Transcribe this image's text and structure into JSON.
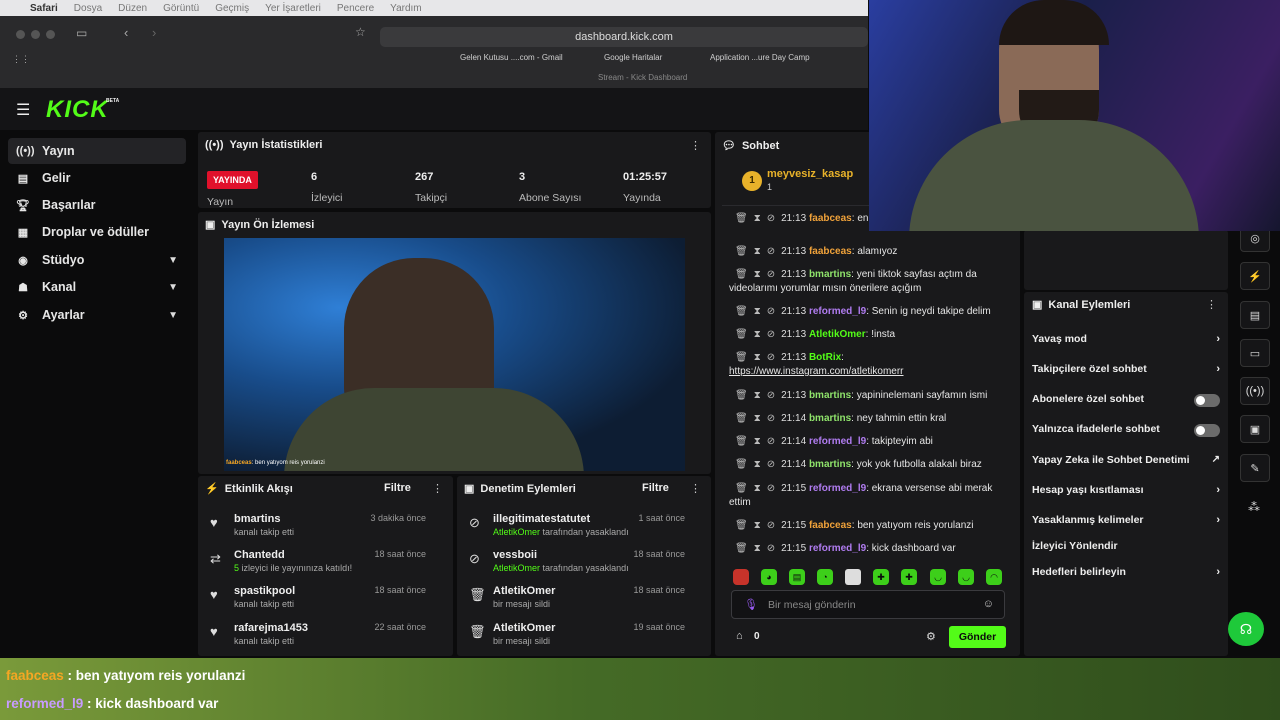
{
  "menubar": {
    "apple": "",
    "items": [
      "Safari",
      "Dosya",
      "Düzen",
      "Görüntü",
      "Geçmiş",
      "Yer İşaretleri",
      "Pencere",
      "Yardım"
    ]
  },
  "browser": {
    "url": "dashboard.kick.com",
    "bookmarks": [
      "Gelen Kutusu ....com - Gmail",
      "Google Haritalar",
      "Application ...ure Day Camp"
    ],
    "tab": "Stream - Kick Dashboard"
  },
  "brand": {
    "name": "KICK",
    "beta": "BETA",
    "accent": "#53fc18"
  },
  "sidebar": {
    "items": [
      {
        "label": "Yayın",
        "icon": "broadcast-icon",
        "active": true
      },
      {
        "label": "Gelir",
        "icon": "chart-icon"
      },
      {
        "label": "Başarılar",
        "icon": "trophy-icon"
      },
      {
        "label": "Droplar ve ödüller",
        "icon": "gift-icon"
      },
      {
        "label": "Stüdyo",
        "icon": "studio-icon",
        "chevron": true
      },
      {
        "label": "Kanal",
        "icon": "channel-icon",
        "chevron": true
      },
      {
        "label": "Ayarlar",
        "icon": "gear-icon",
        "chevron": true
      }
    ]
  },
  "stats": {
    "title": "Yayın İstatistikleri",
    "live": "YAYINDA",
    "stream_label": "Yayın",
    "viewers": "6",
    "viewers_label": "İzleyici",
    "followers": "267",
    "followers_label": "Takipçi",
    "subs": "3",
    "subs_label": "Abone Sayısı",
    "duration": "01:25:57",
    "duration_label": "Yayında"
  },
  "preview": {
    "title": "Yayın Ön İzlemesi",
    "caption_user": "faabceas",
    "caption_text": "ben yatıyom reis yorulanzi"
  },
  "activity": {
    "title": "Etkinlik Akışı",
    "filter": "Filtre",
    "rows": [
      {
        "name": "bmartins",
        "desc": "kanalı takip etti",
        "time": "3 dakika önce",
        "icon": "heart-icon"
      },
      {
        "name": "Chantedd",
        "desc_green": "5",
        "desc": "izleyici ile yayınınıza katıldı!",
        "time": "18 saat önce",
        "icon": "raid-icon"
      },
      {
        "name": "spastikpool",
        "desc": "kanalı takip etti",
        "time": "18 saat önce",
        "icon": "heart-icon"
      },
      {
        "name": "rafarejma1453",
        "desc": "kanalı takip etti",
        "time": "22 saat önce",
        "icon": "heart-icon"
      }
    ]
  },
  "moderation": {
    "title": "Denetim Eylemleri",
    "filter": "Filtre",
    "rows": [
      {
        "name": "illegitimatestatutet",
        "desc_green": "AtletikOmer",
        "desc": "tarafından yasaklandı",
        "time": "1 saat önce",
        "icon": "ban-icon"
      },
      {
        "name": "vessboii",
        "desc_green": "AtletikOmer",
        "desc": "tarafından yasaklandı",
        "time": "18 saat önce",
        "icon": "ban-icon"
      },
      {
        "name": "AtletikOmer",
        "desc": "bir mesajı sildi",
        "time": "18 saat önce",
        "icon": "trash-icon"
      },
      {
        "name": "AtletikOmer",
        "desc": "bir mesajı sildi",
        "time": "19 saat önce",
        "icon": "trash-icon"
      }
    ]
  },
  "chat": {
    "title": "Sohbet",
    "pinned_user": "meyvesiz_kasap",
    "pinned_rank": "1",
    "pinned_count": "1",
    "placeholder": "Bir mesaj gönderin",
    "send": "Gönder",
    "points": "0",
    "lines": [
      {
        "time": "21:13",
        "user": "faabceas",
        "color": "#f0a23a",
        "text": "en yoğunlaşsak okeyde"
      },
      {
        "time": "21:13",
        "user": "faabceas",
        "color": "#f0a23a",
        "text": "alamıyoz"
      },
      {
        "time": "21:13",
        "user": "bmartins",
        "color": "#8fe36b",
        "text": "yeni tiktok sayfası açtım da videolarımı yorumlar mısın önerilere açığım"
      },
      {
        "time": "21:13",
        "user": "reformed_l9",
        "color": "#b07cf0",
        "text": "Senin ig neydi takipe delim"
      },
      {
        "time": "21:13",
        "user": "AtletikOmer",
        "color": "#53fc18",
        "text": "!insta"
      },
      {
        "time": "21:13",
        "user": "BotRix",
        "color": "#53fc18",
        "text": "https://www.instagram.com/atletikomerr"
      },
      {
        "time": "21:13",
        "user": "bmartins",
        "color": "#8fe36b",
        "text": "yapininelemani sayfamın ismi"
      },
      {
        "time": "21:14",
        "user": "bmartins",
        "color": "#8fe36b",
        "text": "ney tahmin ettin kral"
      },
      {
        "time": "21:14",
        "user": "reformed_l9",
        "color": "#b07cf0",
        "text": "takipteyim abi"
      },
      {
        "time": "21:14",
        "user": "bmartins",
        "color": "#8fe36b",
        "text": "yok yok futbolla alakalı biraz"
      },
      {
        "time": "21:15",
        "user": "reformed_l9",
        "color": "#b07cf0",
        "text": "ekrana versense abi merak ettim"
      },
      {
        "time": "21:15",
        "user": "faabceas",
        "color": "#f0a23a",
        "text": "ben yatıyom reis yorulanzi"
      },
      {
        "time": "21:15",
        "user": "reformed_l9",
        "color": "#b07cf0",
        "text": "kick dashboard var"
      }
    ]
  },
  "channel_actions": {
    "title": "Kanal Eylemleri",
    "rows": [
      {
        "label": "Yavaş mod",
        "kind": "chevron"
      },
      {
        "label": "Takipçilere özel sohbet",
        "kind": "chevron"
      },
      {
        "label": "Abonelere özel sohbet",
        "kind": "toggle"
      },
      {
        "label": "Yalnızca ifadelerle sohbet",
        "kind": "toggle"
      },
      {
        "label": "Yapay Zeka ile Sohbet Denetimi",
        "kind": "external"
      },
      {
        "label": "Hesap yaşı kısıtlaması",
        "kind": "chevron"
      },
      {
        "label": "Yasaklanmış kelimeler",
        "kind": "chevron"
      },
      {
        "label": "İzleyici Yönlendir",
        "kind": "none"
      },
      {
        "label": "Hedefleri belirleyin",
        "kind": "chevron"
      }
    ]
  },
  "overlay": {
    "lines": [
      {
        "user": "faabceas",
        "color": "#f5a623",
        "text": "ben yatıyom reis yorulanzi"
      },
      {
        "user": "reformed_l9",
        "color": "#c79bff",
        "text": "kick dashboard var"
      }
    ]
  }
}
